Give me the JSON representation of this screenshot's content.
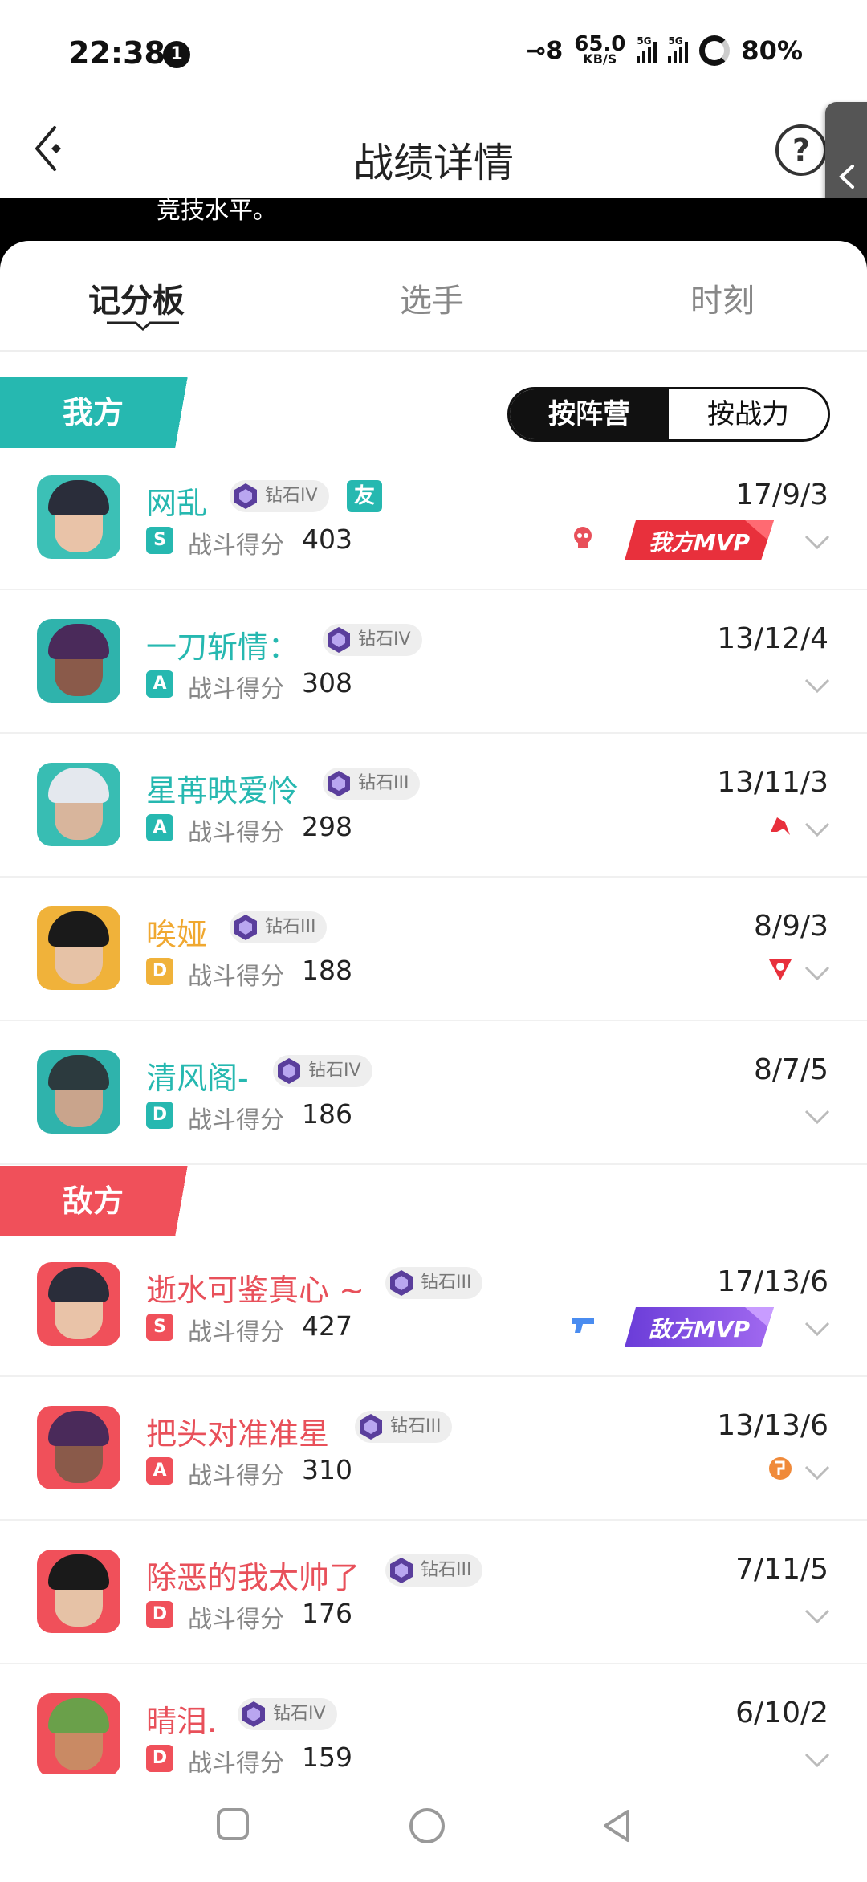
{
  "status": {
    "time": "22:38",
    "notification_count": "1",
    "network_indicator": "⊸8",
    "speed_value": "65.0",
    "speed_unit": "KB/S",
    "sim1_label": "5G",
    "sim2_label": "5G",
    "battery": "80%"
  },
  "header": {
    "title": "战绩详情",
    "help_label": "?",
    "banner_text": "竞技水平。"
  },
  "tabs": [
    {
      "label": "记分板",
      "active": true
    },
    {
      "label": "选手",
      "active": false
    },
    {
      "label": "时刻",
      "active": false
    }
  ],
  "toggle": {
    "by_camp": "按阵营",
    "by_power": "按战力"
  },
  "teams": {
    "ally_label": "我方",
    "enemy_label": "敌方",
    "ally_color": "#26b8b0",
    "enemy_color": "#f0505a"
  },
  "score_label": "战斗得分",
  "mvp": {
    "ally": "我方MVP",
    "enemy": "敌方MVP"
  },
  "ally_players": [
    {
      "name": "网乱",
      "rank": "钻石IV",
      "friend": "友",
      "grade": "S",
      "score": "403",
      "kda": "17/9/3",
      "icon": "skull-icon"
    },
    {
      "name": "一刀斩情：",
      "rank": "钻石IV",
      "grade": "A",
      "score": "308",
      "kda": "13/12/4"
    },
    {
      "name": "星苒映爱怜",
      "rank": "钻石III",
      "grade": "A",
      "score": "298",
      "kda": "13/11/3",
      "icon": "red-arrow-icon"
    },
    {
      "name": "唉娅",
      "rank": "钻石III",
      "grade": "D",
      "score": "188",
      "kda": "8/9/3",
      "icon": "triangle-badge-icon"
    },
    {
      "name": "清风阁-",
      "rank": "钻石IV",
      "grade": "D",
      "score": "186",
      "kda": "8/7/5"
    }
  ],
  "enemy_players": [
    {
      "name": "逝水可鉴真心 ~",
      "rank": "钻石III",
      "grade": "S",
      "score": "427",
      "kda": "17/13/6",
      "icon": "pistol-icon"
    },
    {
      "name": "把头对准准星",
      "rank": "钻石III",
      "grade": "A",
      "score": "310",
      "kda": "13/13/6",
      "icon": "orange-badge-icon"
    },
    {
      "name": "除恶的我太帅了",
      "rank": "钻石III",
      "grade": "D",
      "score": "176",
      "kda": "7/11/5"
    },
    {
      "name": "晴泪.",
      "rank": "钻石IV",
      "grade": "D",
      "score": "159",
      "kda": "6/10/2"
    }
  ]
}
